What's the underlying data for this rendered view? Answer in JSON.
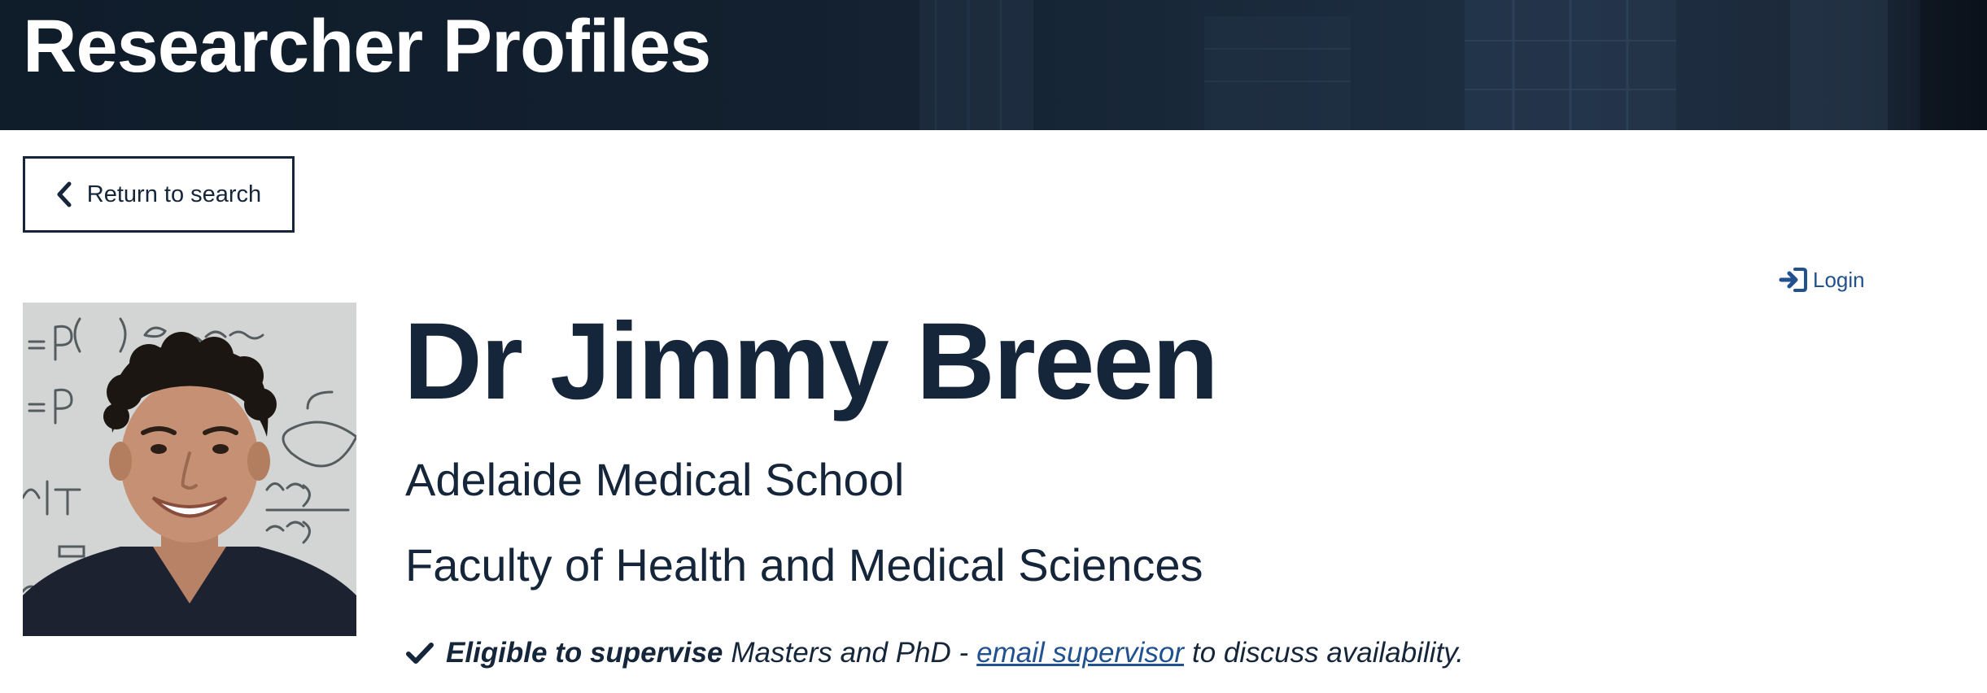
{
  "header": {
    "title": "Researcher Profiles"
  },
  "nav": {
    "return_label": "Return to search",
    "login_label": "Login"
  },
  "profile": {
    "name": "Dr Jimmy Breen",
    "school": "Adelaide Medical School",
    "faculty": "Faculty of Health and Medical Sciences",
    "supervision": {
      "bold_text": "Eligible to supervise",
      "levels_text": "Masters and PhD -",
      "link_text": "email supervisor",
      "suffix_text": "to discuss availability."
    }
  },
  "icons": {
    "return": "chevron-left-icon",
    "login": "sign-in-icon",
    "eligible": "check-icon"
  },
  "colors": {
    "banner": "#13202f",
    "text": "#16263a",
    "link": "#21528f"
  }
}
